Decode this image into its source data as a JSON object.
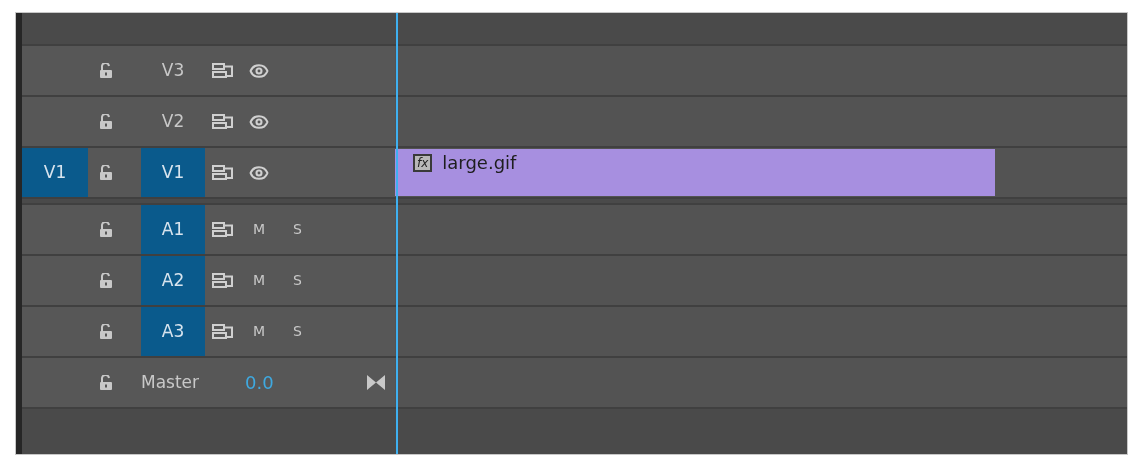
{
  "video_tracks": [
    {
      "name": "V3",
      "targeted": false
    },
    {
      "name": "V2",
      "targeted": false
    },
    {
      "name": "V1",
      "source_patch": "V1",
      "targeted": true,
      "clips": [
        {
          "fx": "fx",
          "name": "large.gif"
        }
      ]
    }
  ],
  "audio_tracks": [
    {
      "name": "A1",
      "targeted": true,
      "mute": "M",
      "solo": "S"
    },
    {
      "name": "A2",
      "targeted": true,
      "mute": "M",
      "solo": "S"
    },
    {
      "name": "A3",
      "targeted": true,
      "mute": "M",
      "solo": "S"
    }
  ],
  "master": {
    "name": "Master",
    "value": "0.0"
  }
}
